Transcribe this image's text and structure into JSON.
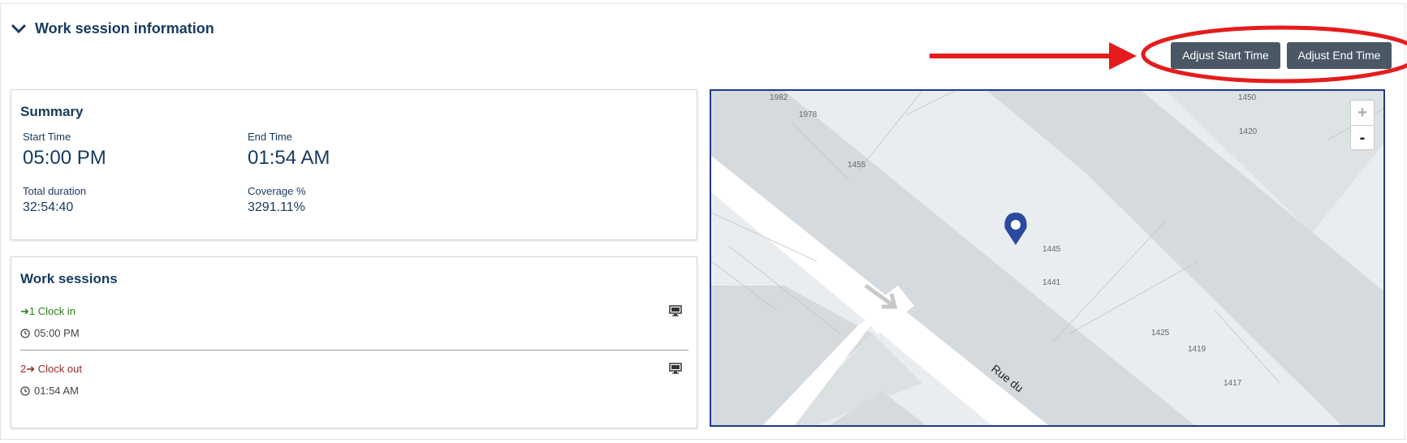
{
  "section": {
    "title": "Work session information"
  },
  "toolbar": {
    "adjust_start_label": "Adjust Start Time",
    "adjust_end_label": "Adjust End Time"
  },
  "summary": {
    "title": "Summary",
    "start_label": "Start Time",
    "start_value": "05:00 PM",
    "end_label": "End Time",
    "end_value": "01:54 AM",
    "duration_label": "Total duration",
    "duration_value": "32:54:40",
    "coverage_label": "Coverage %",
    "coverage_value": "3291.11%"
  },
  "sessions": {
    "title": "Work sessions",
    "items": [
      {
        "label": "➜1 Clock in",
        "time": "05:00 PM",
        "color": "#2e7d1f"
      },
      {
        "label": "2➜ Clock out",
        "time": "01:54 AM",
        "color": "#9a2a2a"
      }
    ]
  },
  "map": {
    "zoom_in": "+",
    "zoom_out": "-",
    "street": "Rue du",
    "numbers": [
      "1982",
      "1978",
      "1455",
      "1450",
      "1420",
      "1445",
      "1441",
      "1425",
      "1419",
      "1417"
    ]
  },
  "colors": {
    "accent": "#173a5e",
    "button": "#4a5865",
    "annotation": "#e51c1c"
  }
}
